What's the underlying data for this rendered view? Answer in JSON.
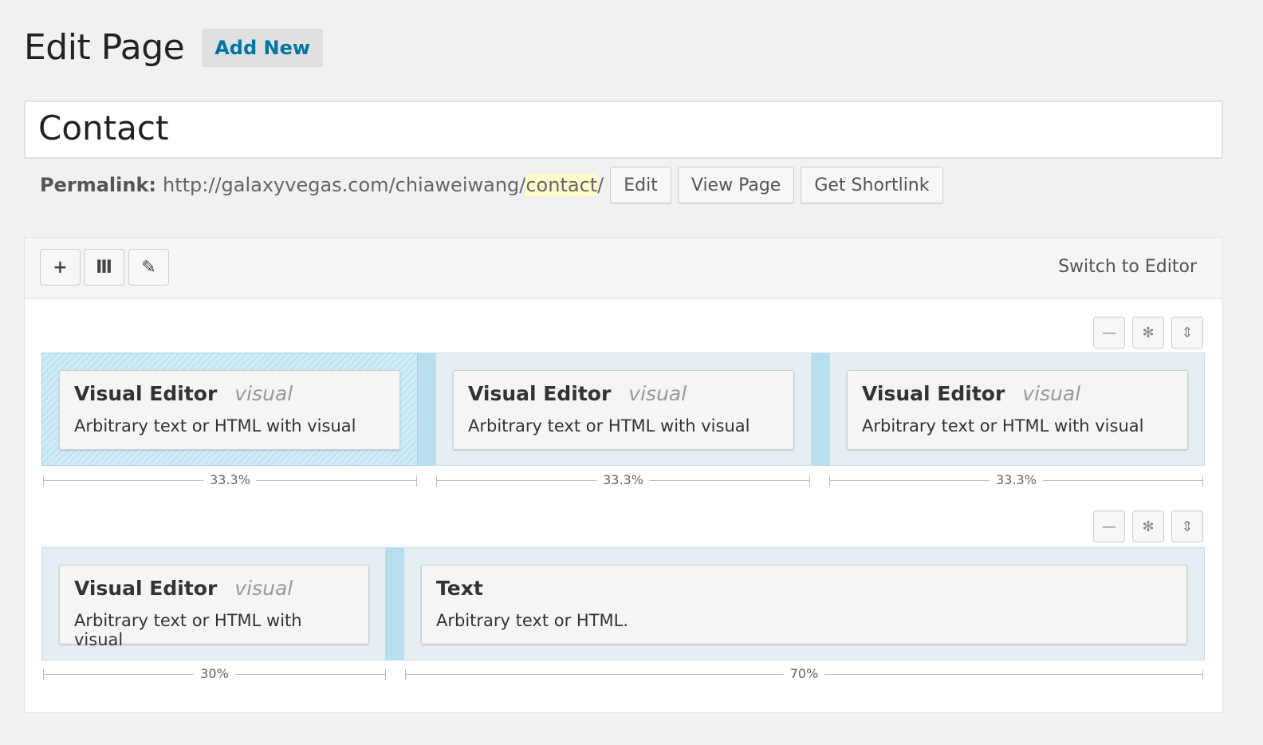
{
  "header": {
    "title": "Edit Page",
    "add_new_label": "Add New"
  },
  "post": {
    "title": "Contact",
    "permalink_label": "Permalink:",
    "permalink_base": "http://galaxyvegas.com/chiaweiwang/",
    "permalink_slug": "contact",
    "permalink_trailing": "/",
    "edit_label": "Edit",
    "view_label": "View Page",
    "shortlink_label": "Get Shortlink"
  },
  "builder": {
    "toolbar": {
      "add_icon": "+",
      "columns_icon": "Ⅲ",
      "brush_icon": "✎",
      "switch_label": "Switch to Editor"
    },
    "row_controls": {
      "collapse_icon": "—",
      "settings_icon": "✻",
      "move_icon": "⇕"
    },
    "rows": [
      {
        "cells": [
          {
            "title": "Visual Editor",
            "type": "visual",
            "desc": "Arbitrary text or HTML with visual",
            "width_label": "33.3%"
          },
          {
            "title": "Visual Editor",
            "type": "visual",
            "desc": "Arbitrary text or HTML with visual",
            "width_label": "33.3%"
          },
          {
            "title": "Visual Editor",
            "type": "visual",
            "desc": "Arbitrary text or HTML with visual",
            "width_label": "33.3%"
          }
        ]
      },
      {
        "cells": [
          {
            "title": "Visual Editor",
            "type": "visual",
            "desc": "Arbitrary text or HTML with visual",
            "width_label": "30%"
          },
          {
            "title": "Text",
            "type": "",
            "desc": "Arbitrary text or HTML.",
            "width_label": "70%"
          }
        ]
      }
    ]
  },
  "colors": {
    "link": "#0074a2",
    "cell_bg": "#e4eef3",
    "gutter": "#b6dff0",
    "slug_highlight": "#fffbcc"
  }
}
